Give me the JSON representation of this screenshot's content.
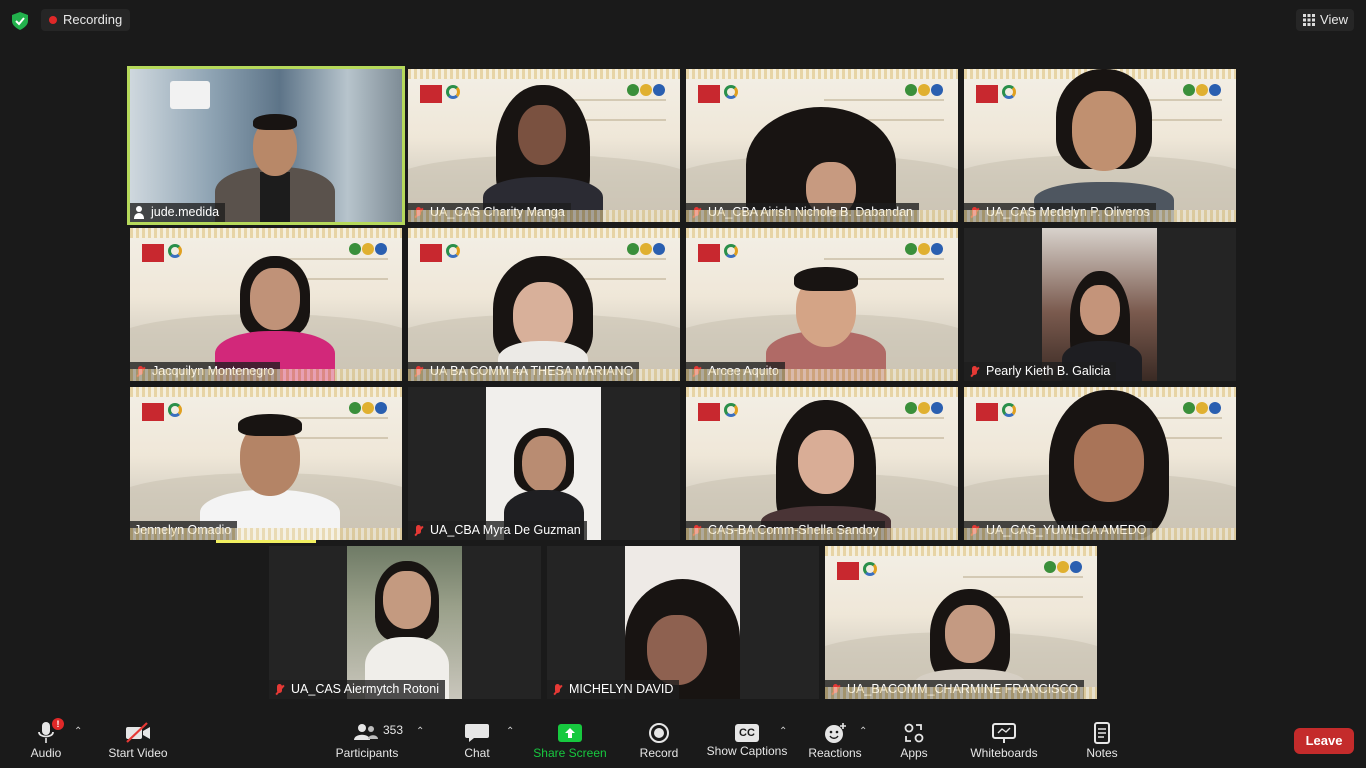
{
  "top": {
    "recording_label": "Recording",
    "view_label": "View"
  },
  "participants": [
    {
      "name": "jude.medida"
    },
    {
      "name": "UA_CAS Charity Manga"
    },
    {
      "name": "UA_CBA Airish Nichole B. Dabandan"
    },
    {
      "name": "UA_CAS Medelyn P. Oliveros"
    },
    {
      "name": "Jacquilyn Montenegro"
    },
    {
      "name": "UA BA COMM 4A THESA MARIANO"
    },
    {
      "name": "Arcee Aquito"
    },
    {
      "name": "Pearly Kieth B. Galicia"
    },
    {
      "name": "Jennelyn Omadio"
    },
    {
      "name": "UA_CBA Myra De Guzman"
    },
    {
      "name": "CAS-BA Comm-Shella Sandoy"
    },
    {
      "name": "UA_CAS_YUMILCA AMEDO"
    },
    {
      "name": "UA_CAS Aiermytch Rotoni"
    },
    {
      "name": "MICHELYN DAVID"
    },
    {
      "name": "UA_BACOMM_CHARMINE FRANCISCO"
    }
  ],
  "toolbar": {
    "audio": "Audio",
    "audio_badge": "!",
    "start_video": "Start Video",
    "participants": "Participants",
    "participant_count": "353",
    "chat": "Chat",
    "share_screen": "Share Screen",
    "record": "Record",
    "show_captions": "Show Captions",
    "cc": "CC",
    "reactions": "Reactions",
    "apps": "Apps",
    "whiteboards": "Whiteboards",
    "notes": "Notes",
    "leave": "Leave"
  },
  "colors": {
    "speaker_border": "#b6d95b",
    "share_green": "#17c93f",
    "leave_red": "#c42b2b",
    "mute_red": "#e53935"
  }
}
